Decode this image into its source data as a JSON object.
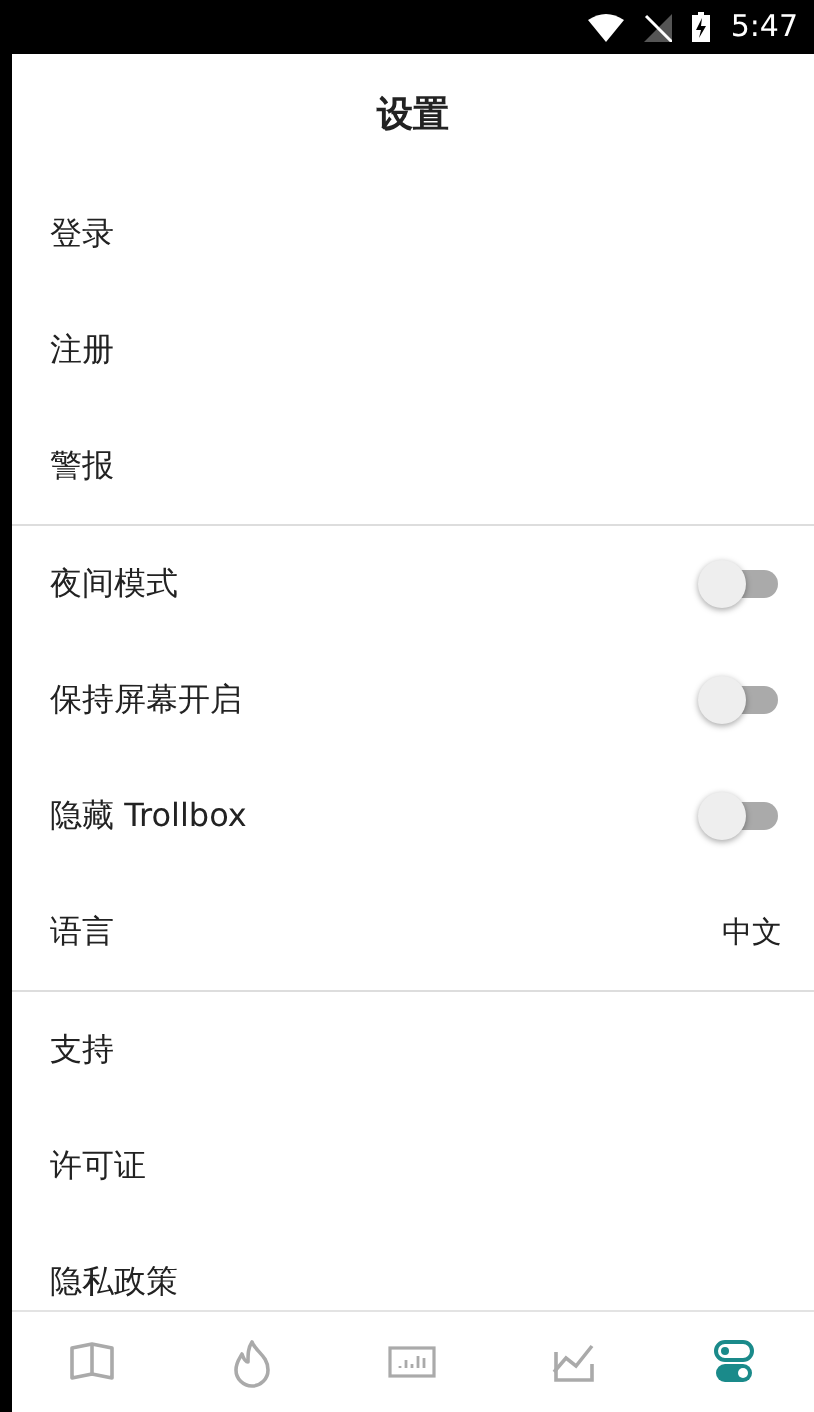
{
  "status_bar": {
    "time": "5:47"
  },
  "header": {
    "title": "设置"
  },
  "sections": [
    {
      "items": [
        {
          "kind": "link",
          "label": "登录"
        },
        {
          "kind": "link",
          "label": "注册"
        },
        {
          "kind": "link",
          "label": "警报"
        }
      ]
    },
    {
      "items": [
        {
          "kind": "toggle",
          "label": "夜间模式",
          "on": false
        },
        {
          "kind": "toggle",
          "label": "保持屏幕开启",
          "on": false
        },
        {
          "kind": "toggle",
          "label": "隐藏 Trollbox",
          "on": false
        },
        {
          "kind": "value",
          "label": "语言",
          "value": "中文"
        }
      ]
    },
    {
      "items": [
        {
          "kind": "link",
          "label": "支持"
        },
        {
          "kind": "link",
          "label": "许可证"
        },
        {
          "kind": "link",
          "label": "隐私政策"
        }
      ]
    }
  ],
  "bottom_nav": [
    {
      "selected": false
    },
    {
      "selected": false
    },
    {
      "selected": false
    },
    {
      "selected": false
    },
    {
      "selected": true
    }
  ]
}
